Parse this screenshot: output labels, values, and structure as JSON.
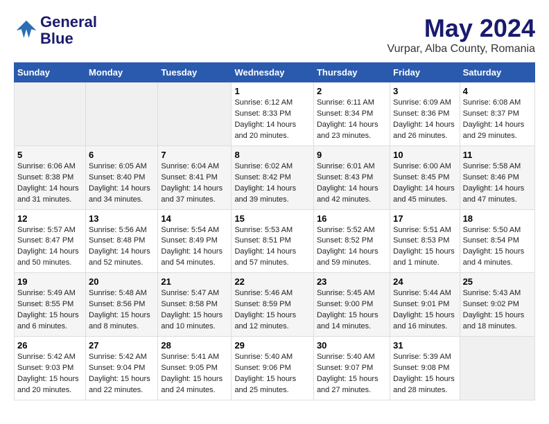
{
  "header": {
    "logo_line1": "General",
    "logo_line2": "Blue",
    "title": "May 2024",
    "subtitle": "Vurpar, Alba County, Romania"
  },
  "weekdays": [
    "Sunday",
    "Monday",
    "Tuesday",
    "Wednesday",
    "Thursday",
    "Friday",
    "Saturday"
  ],
  "weeks": [
    [
      {
        "day": "",
        "empty": true
      },
      {
        "day": "",
        "empty": true
      },
      {
        "day": "",
        "empty": true
      },
      {
        "day": "1",
        "sunrise": "6:12 AM",
        "sunset": "8:33 PM",
        "daylight": "14 hours and 20 minutes."
      },
      {
        "day": "2",
        "sunrise": "6:11 AM",
        "sunset": "8:34 PM",
        "daylight": "14 hours and 23 minutes."
      },
      {
        "day": "3",
        "sunrise": "6:09 AM",
        "sunset": "8:36 PM",
        "daylight": "14 hours and 26 minutes."
      },
      {
        "day": "4",
        "sunrise": "6:08 AM",
        "sunset": "8:37 PM",
        "daylight": "14 hours and 29 minutes."
      }
    ],
    [
      {
        "day": "5",
        "sunrise": "6:06 AM",
        "sunset": "8:38 PM",
        "daylight": "14 hours and 31 minutes."
      },
      {
        "day": "6",
        "sunrise": "6:05 AM",
        "sunset": "8:40 PM",
        "daylight": "14 hours and 34 minutes."
      },
      {
        "day": "7",
        "sunrise": "6:04 AM",
        "sunset": "8:41 PM",
        "daylight": "14 hours and 37 minutes."
      },
      {
        "day": "8",
        "sunrise": "6:02 AM",
        "sunset": "8:42 PM",
        "daylight": "14 hours and 39 minutes."
      },
      {
        "day": "9",
        "sunrise": "6:01 AM",
        "sunset": "8:43 PM",
        "daylight": "14 hours and 42 minutes."
      },
      {
        "day": "10",
        "sunrise": "6:00 AM",
        "sunset": "8:45 PM",
        "daylight": "14 hours and 45 minutes."
      },
      {
        "day": "11",
        "sunrise": "5:58 AM",
        "sunset": "8:46 PM",
        "daylight": "14 hours and 47 minutes."
      }
    ],
    [
      {
        "day": "12",
        "sunrise": "5:57 AM",
        "sunset": "8:47 PM",
        "daylight": "14 hours and 50 minutes."
      },
      {
        "day": "13",
        "sunrise": "5:56 AM",
        "sunset": "8:48 PM",
        "daylight": "14 hours and 52 minutes."
      },
      {
        "day": "14",
        "sunrise": "5:54 AM",
        "sunset": "8:49 PM",
        "daylight": "14 hours and 54 minutes."
      },
      {
        "day": "15",
        "sunrise": "5:53 AM",
        "sunset": "8:51 PM",
        "daylight": "14 hours and 57 minutes."
      },
      {
        "day": "16",
        "sunrise": "5:52 AM",
        "sunset": "8:52 PM",
        "daylight": "14 hours and 59 minutes."
      },
      {
        "day": "17",
        "sunrise": "5:51 AM",
        "sunset": "8:53 PM",
        "daylight": "15 hours and 1 minute."
      },
      {
        "day": "18",
        "sunrise": "5:50 AM",
        "sunset": "8:54 PM",
        "daylight": "15 hours and 4 minutes."
      }
    ],
    [
      {
        "day": "19",
        "sunrise": "5:49 AM",
        "sunset": "8:55 PM",
        "daylight": "15 hours and 6 minutes."
      },
      {
        "day": "20",
        "sunrise": "5:48 AM",
        "sunset": "8:56 PM",
        "daylight": "15 hours and 8 minutes."
      },
      {
        "day": "21",
        "sunrise": "5:47 AM",
        "sunset": "8:58 PM",
        "daylight": "15 hours and 10 minutes."
      },
      {
        "day": "22",
        "sunrise": "5:46 AM",
        "sunset": "8:59 PM",
        "daylight": "15 hours and 12 minutes."
      },
      {
        "day": "23",
        "sunrise": "5:45 AM",
        "sunset": "9:00 PM",
        "daylight": "15 hours and 14 minutes."
      },
      {
        "day": "24",
        "sunrise": "5:44 AM",
        "sunset": "9:01 PM",
        "daylight": "15 hours and 16 minutes."
      },
      {
        "day": "25",
        "sunrise": "5:43 AM",
        "sunset": "9:02 PM",
        "daylight": "15 hours and 18 minutes."
      }
    ],
    [
      {
        "day": "26",
        "sunrise": "5:42 AM",
        "sunset": "9:03 PM",
        "daylight": "15 hours and 20 minutes."
      },
      {
        "day": "27",
        "sunrise": "5:42 AM",
        "sunset": "9:04 PM",
        "daylight": "15 hours and 22 minutes."
      },
      {
        "day": "28",
        "sunrise": "5:41 AM",
        "sunset": "9:05 PM",
        "daylight": "15 hours and 24 minutes."
      },
      {
        "day": "29",
        "sunrise": "5:40 AM",
        "sunset": "9:06 PM",
        "daylight": "15 hours and 25 minutes."
      },
      {
        "day": "30",
        "sunrise": "5:40 AM",
        "sunset": "9:07 PM",
        "daylight": "15 hours and 27 minutes."
      },
      {
        "day": "31",
        "sunrise": "5:39 AM",
        "sunset": "9:08 PM",
        "daylight": "15 hours and 28 minutes."
      },
      {
        "day": "",
        "empty": true
      }
    ]
  ]
}
